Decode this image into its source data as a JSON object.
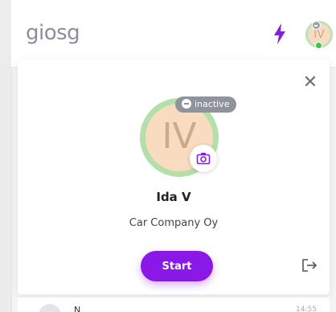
{
  "header": {
    "logo": "giosg",
    "user_initials": "IV"
  },
  "colors": {
    "accent": "#8a18e6",
    "online": "#3cc44f",
    "avatar_ring": "#b5dfa8",
    "avatar_fill": "#f9dcc0"
  },
  "profile_card": {
    "initials": "IV",
    "status": "inactive",
    "name": "Ida V",
    "company": "Car Company Oy",
    "start_label": "Start",
    "icons": {
      "close": "close-icon",
      "camera": "camera-icon",
      "logout": "logout-icon"
    }
  },
  "list_peek": {
    "text": "N",
    "time": "14:55"
  }
}
